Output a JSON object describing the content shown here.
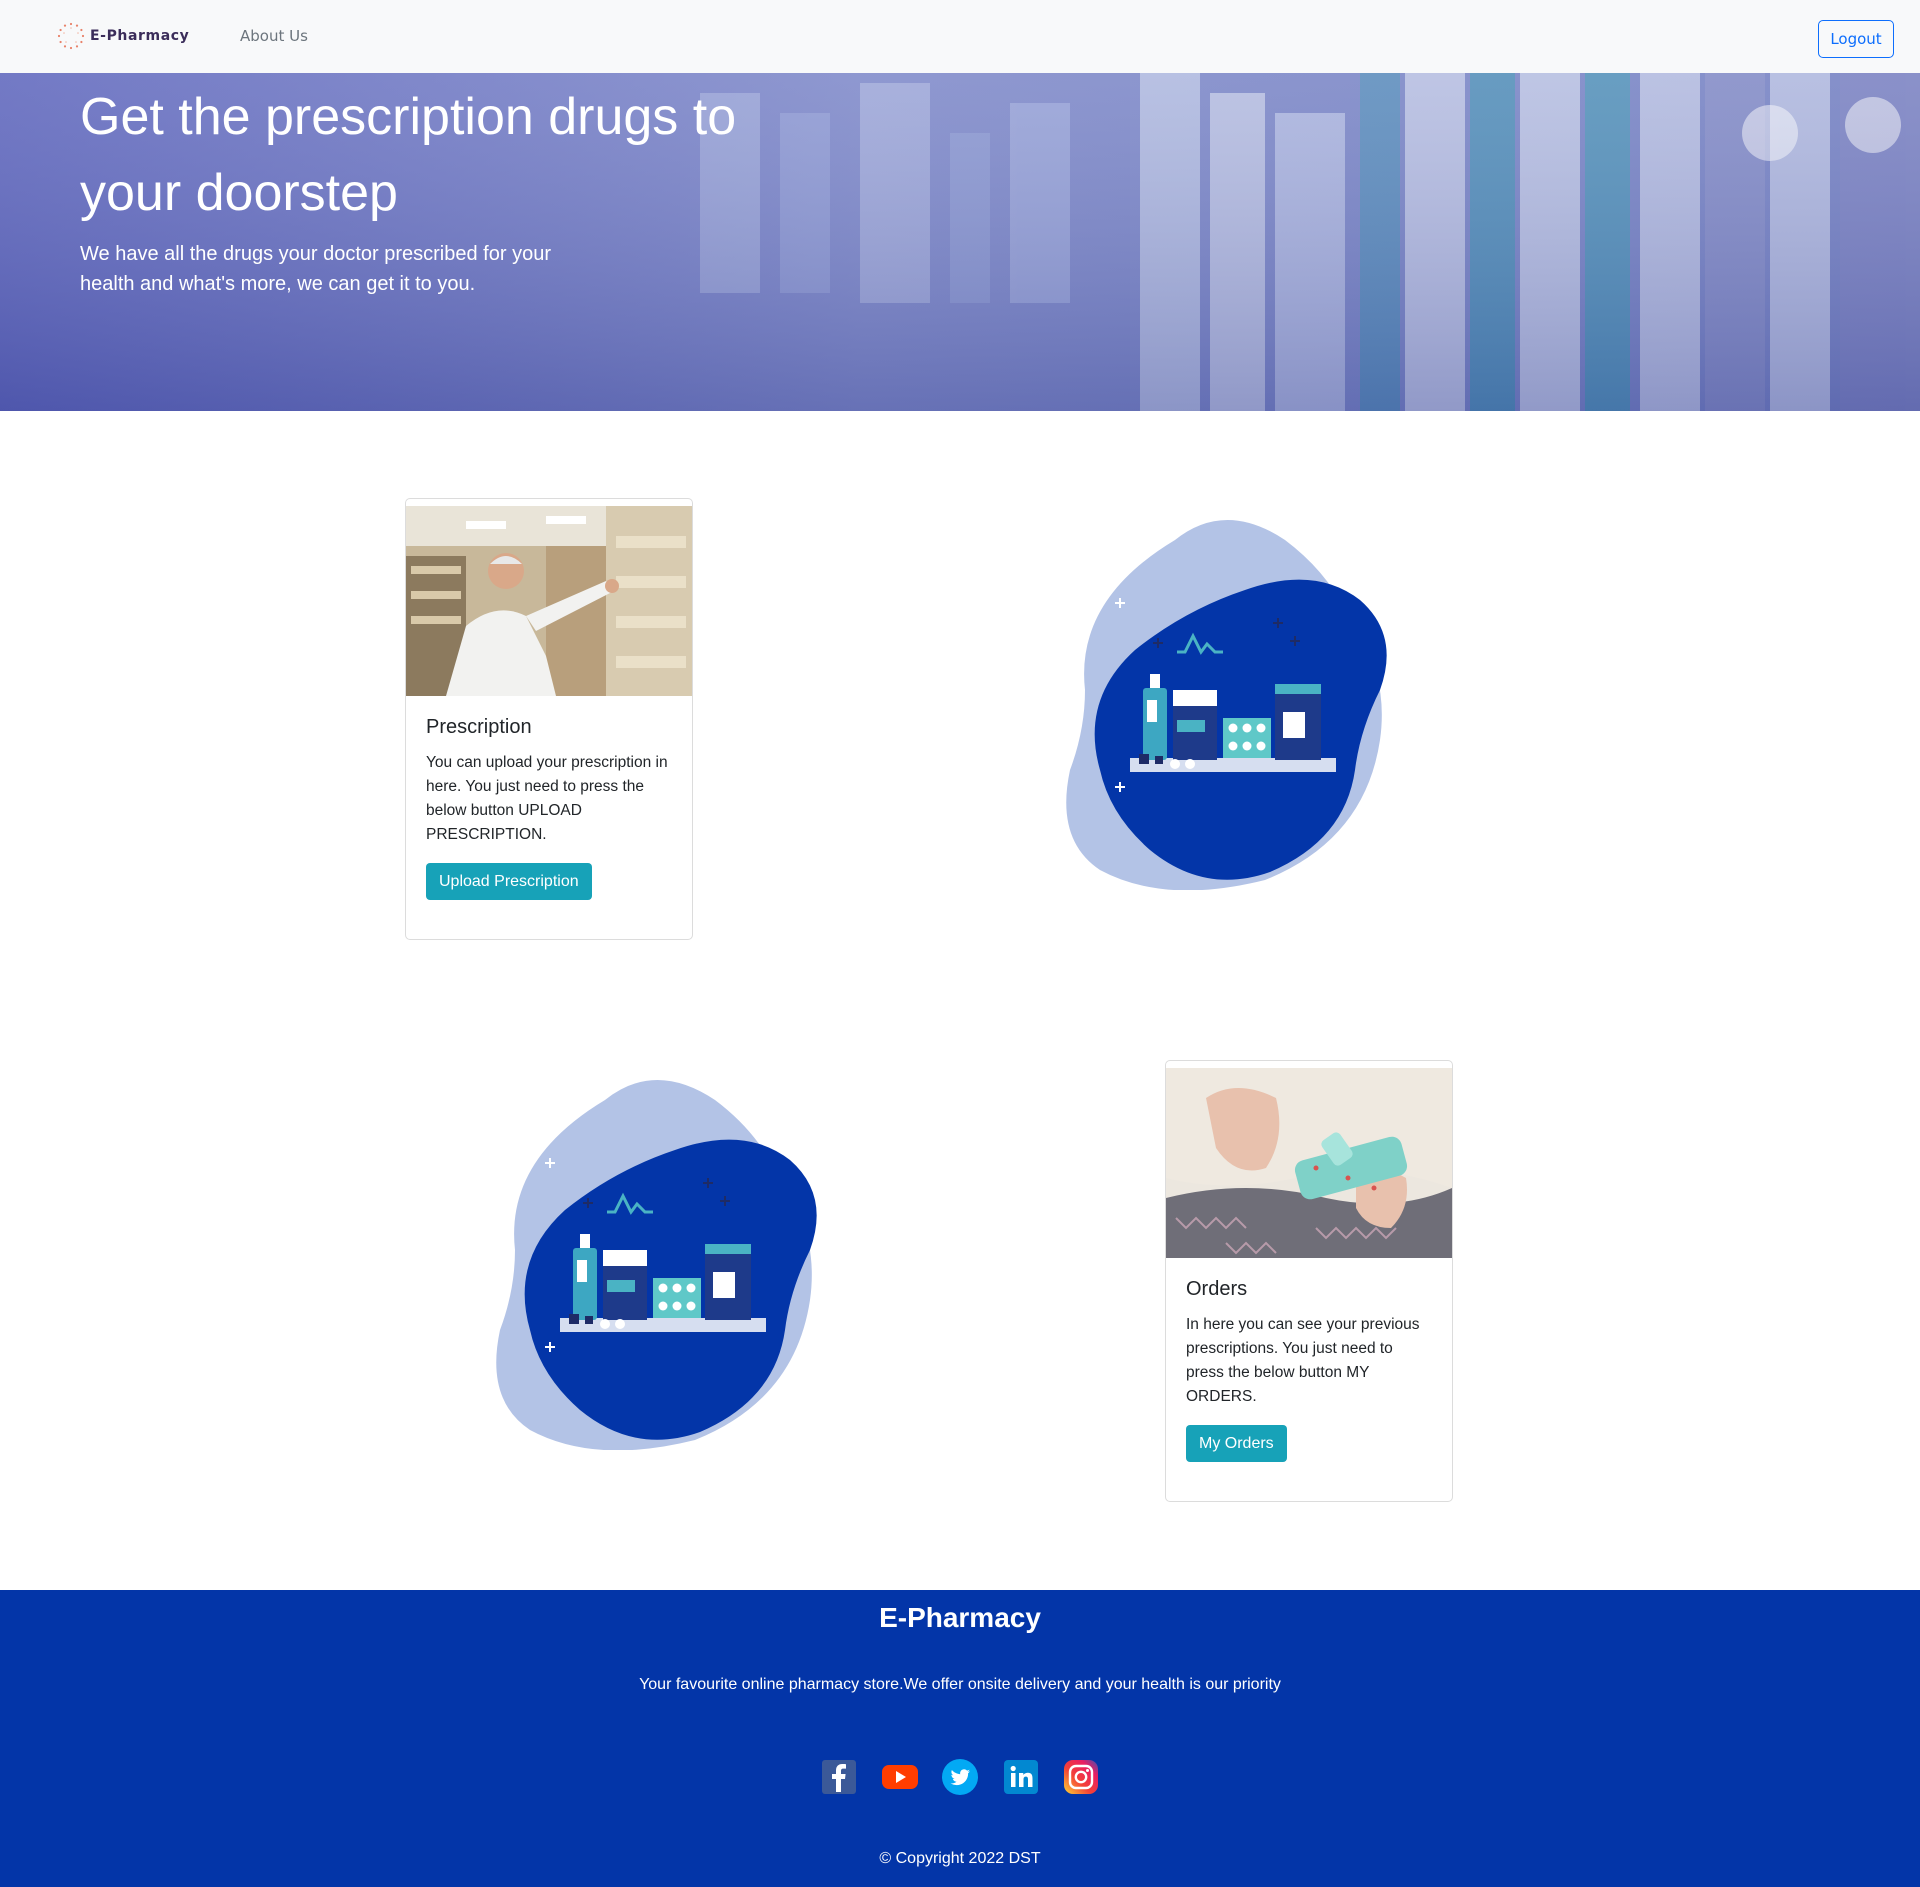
{
  "navbar": {
    "brand": "E-Pharmacy",
    "links": [
      {
        "label": "About Us"
      }
    ],
    "logout_label": "Logout"
  },
  "hero": {
    "title": "Get the prescription drugs to your doorstep",
    "subtitle": "We have all the drugs your doctor prescribed for your health and what's more, we can get it to you."
  },
  "cards": [
    {
      "title": "Prescription",
      "text": "You can upload your prescription in here. You just need to press the below button UPLOAD PRESCRIPTION.",
      "button_label": "Upload Prescription"
    },
    {
      "title": "Orders",
      "text": "In here you can see your previous prescriptions. You just need to press the below button MY ORDERS.",
      "button_label": "My Orders"
    }
  ],
  "footer": {
    "title": "E-Pharmacy",
    "tagline": "Your favourite online pharmacy store.We offer onsite delivery and your health is our priority",
    "socials": [
      "facebook-icon",
      "youtube-icon",
      "twitter-icon",
      "linkedin-icon",
      "instagram-icon"
    ],
    "copyright": "© Copyright 2022 DST"
  },
  "colors": {
    "primary_blue": "#0d6efd",
    "info": "#17a2b8",
    "footer_bg": "#0335a8",
    "hero_overlay": "#5a5fc0"
  }
}
